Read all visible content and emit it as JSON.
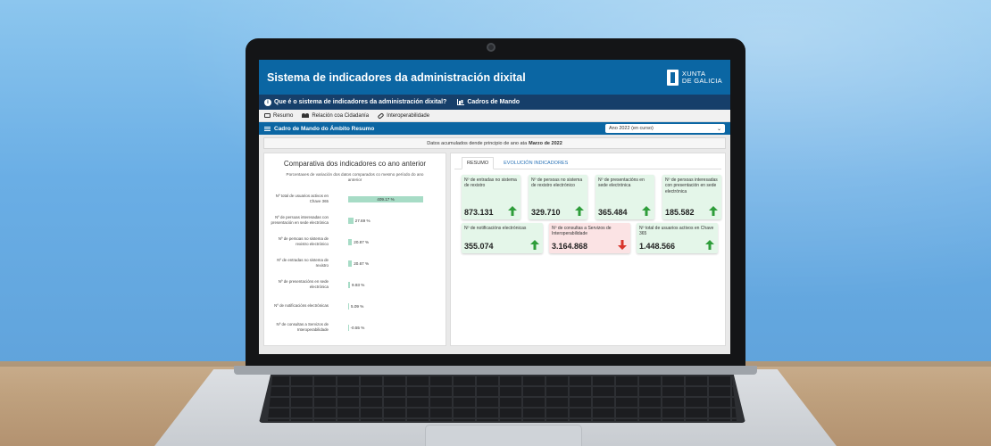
{
  "app": {
    "title": "Sistema de indicadores da administración dixital",
    "logo_line1": "XUNTA",
    "logo_line2": "DE GALICIA"
  },
  "nav": {
    "info_label": "Que é o sistema de indicadores da administración dixital?",
    "dashboards_label": "Cadros de Mando"
  },
  "subnav": {
    "tabs": [
      "Resumo",
      "Relación coa Cidadanía",
      "Interoperabilidade"
    ]
  },
  "dashboard": {
    "title": "Cadro de Mando do Ámbito Resumo",
    "year_select": "Ano 2022 (en curso)"
  },
  "info": {
    "text": "Datos acumulados dende principio de ano ata",
    "period": "Marzo de 2022"
  },
  "comparison": {
    "title": "Comparativa dos indicadores co ano anterior",
    "subtitle": "Porcentaxes de variación dos datos comparados co mesmo período do ano anterior",
    "rows": [
      {
        "label": "Nº total de usuarios activos en Chave 365",
        "value": "409.17 %",
        "pct": 409.17
      },
      {
        "label": "Nº de persoas interesadas con presentación en sede electrónica",
        "value": "27.69 %",
        "pct": 27.69
      },
      {
        "label": "Nº de persoas no sistema de rexistro electrónico",
        "value": "20.87 %",
        "pct": 20.87
      },
      {
        "label": "Nº de entradas no sistema de rexistro",
        "value": "20.67 %",
        "pct": 20.67
      },
      {
        "label": "Nº de presentacións en sede electrónica",
        "value": "9.93 %",
        "pct": 9.93
      },
      {
        "label": "Nº de notificacións electrónicas",
        "value": "5.09 %",
        "pct": 5.09
      },
      {
        "label": "Nº de consultas a Servizos de Interoperabilidade",
        "value": "-0.55 %",
        "pct": -0.55
      }
    ]
  },
  "tabs": [
    "RESUMO",
    "EVOLUCIÓN INDICADORES"
  ],
  "kpis_row1": [
    {
      "label": "Nº de entradas no sistema de rexistro",
      "value": "873.131",
      "trend": "up"
    },
    {
      "label": "Nº de persoas no sistema de rexistro electrónico",
      "value": "329.710",
      "trend": "up"
    },
    {
      "label": "Nº de presentacións en sede electrónica",
      "value": "365.484",
      "trend": "up"
    },
    {
      "label": "Nº de persoas interesadas con presentación en sede electrónica",
      "value": "185.582",
      "trend": "up"
    }
  ],
  "kpis_row2": [
    {
      "label": "Nº de notificacións electrónicas",
      "value": "355.074",
      "trend": "up"
    },
    {
      "label": "Nº de consultas a Servizos de Interoperabilidade",
      "value": "3.164.868",
      "trend": "down"
    },
    {
      "label": "Nº total de usuarios activos en Chave 365",
      "value": "1.448.566",
      "trend": "up"
    }
  ],
  "colors": {
    "header": "#0b66a3",
    "nav": "#163f6a",
    "up": "#2e9d3a",
    "down": "#d9342b",
    "bar": "#a7dcc6"
  }
}
